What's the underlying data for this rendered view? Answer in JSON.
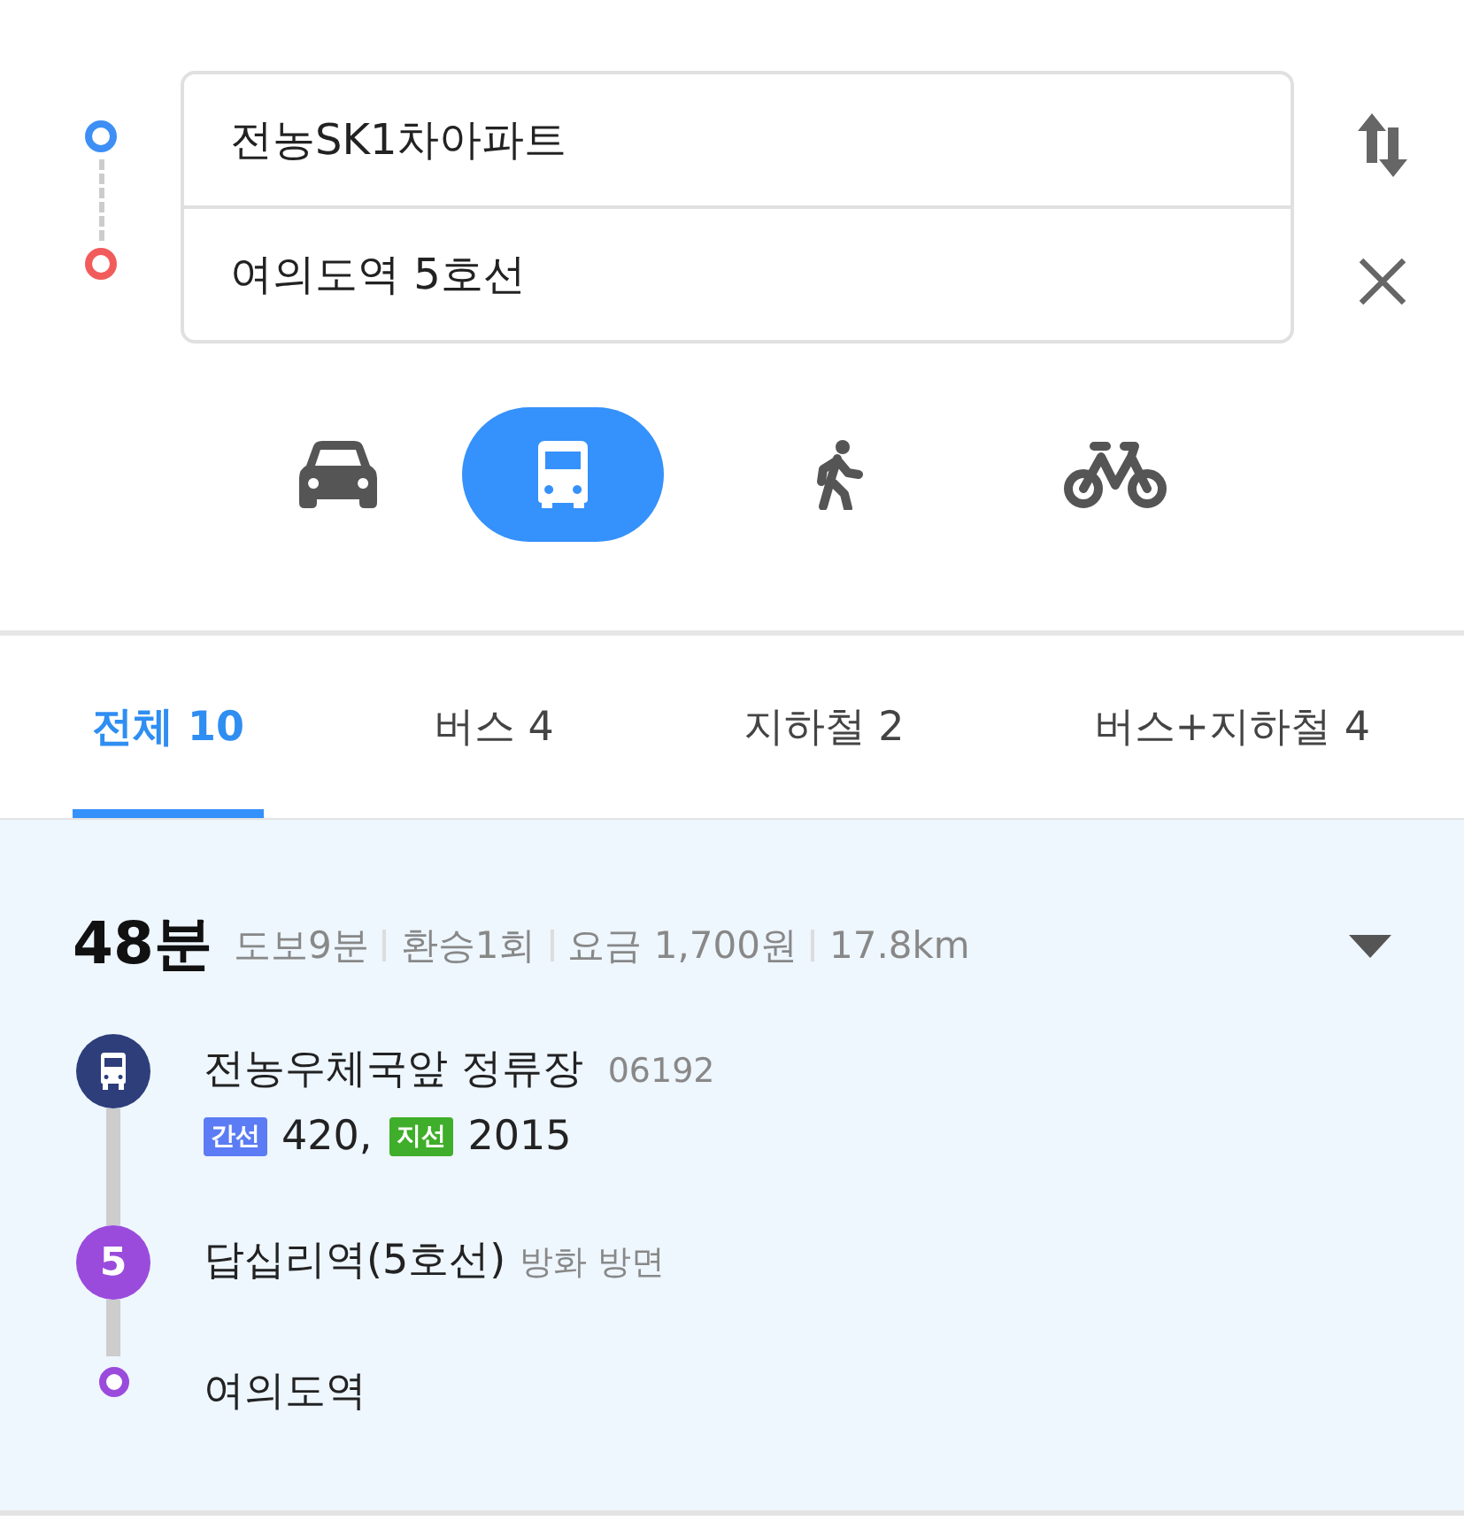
{
  "origin": {
    "value": "전농SK1차아파트"
  },
  "destination": {
    "value": "여의도역 5호선"
  },
  "modes": [
    {
      "kind": "car",
      "selected": false
    },
    {
      "kind": "bus",
      "selected": true
    },
    {
      "kind": "walk",
      "selected": false
    },
    {
      "kind": "bike",
      "selected": false
    }
  ],
  "tabs": [
    {
      "label": "전체 10",
      "selected": true
    },
    {
      "label": "버스 4",
      "selected": false
    },
    {
      "label": "지하철 2",
      "selected": false
    },
    {
      "label": "버스+지하철 4",
      "selected": false
    }
  ],
  "route": {
    "duration": "48분",
    "details": [
      "도보9분",
      "환승1회",
      "요금 1,700원",
      "17.8km"
    ],
    "steps": [
      {
        "kind": "bus",
        "color": "#2d3e7b",
        "name": "전농우체국앞 정류장",
        "code": "06192",
        "lines": [
          {
            "tag": "간선",
            "color": "#5b7cf5",
            "number": "420,"
          },
          {
            "tag": "지선",
            "color": "#3fae2a",
            "number": "2015"
          }
        ]
      },
      {
        "kind": "subway",
        "color": "#9a4bdc",
        "badge": "5",
        "name": "답십리역(5호선)",
        "direction": "방화 방면"
      },
      {
        "kind": "end",
        "color": "#9a4bdc",
        "name": "여의도역"
      }
    ]
  }
}
